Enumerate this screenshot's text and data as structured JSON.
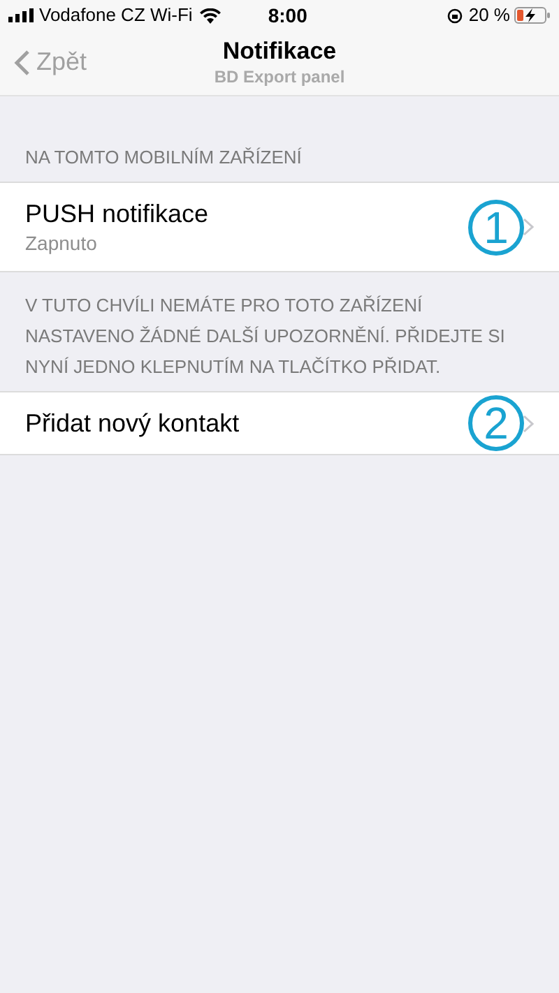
{
  "status_bar": {
    "carrier": "Vodafone CZ Wi-Fi",
    "time": "8:00",
    "battery_percent": "20 %"
  },
  "nav": {
    "back": "Zpět",
    "title": "Notifikace",
    "subtitle": "BD Export panel"
  },
  "sections": [
    {
      "header": "NA TOMTO MOBILNÍM ZAŘÍZENÍ",
      "rows": [
        {
          "title": "PUSH notifikace",
          "subtitle": "Zapnuto",
          "callout": "1"
        }
      ]
    },
    {
      "header": "V TUTO CHVÍLI NEMÁTE PRO TOTO ZAŘÍZENÍ NASTAVENO ŽÁDNÉ DALŠÍ UPOZORNĚNÍ. PŘIDEJTE SI NYNÍ JEDNO KLEPNUTÍM NA TLAČÍTKO PŘIDAT.",
      "rows": [
        {
          "title": "Přidat nový kontakt",
          "callout": "2"
        }
      ]
    }
  ]
}
